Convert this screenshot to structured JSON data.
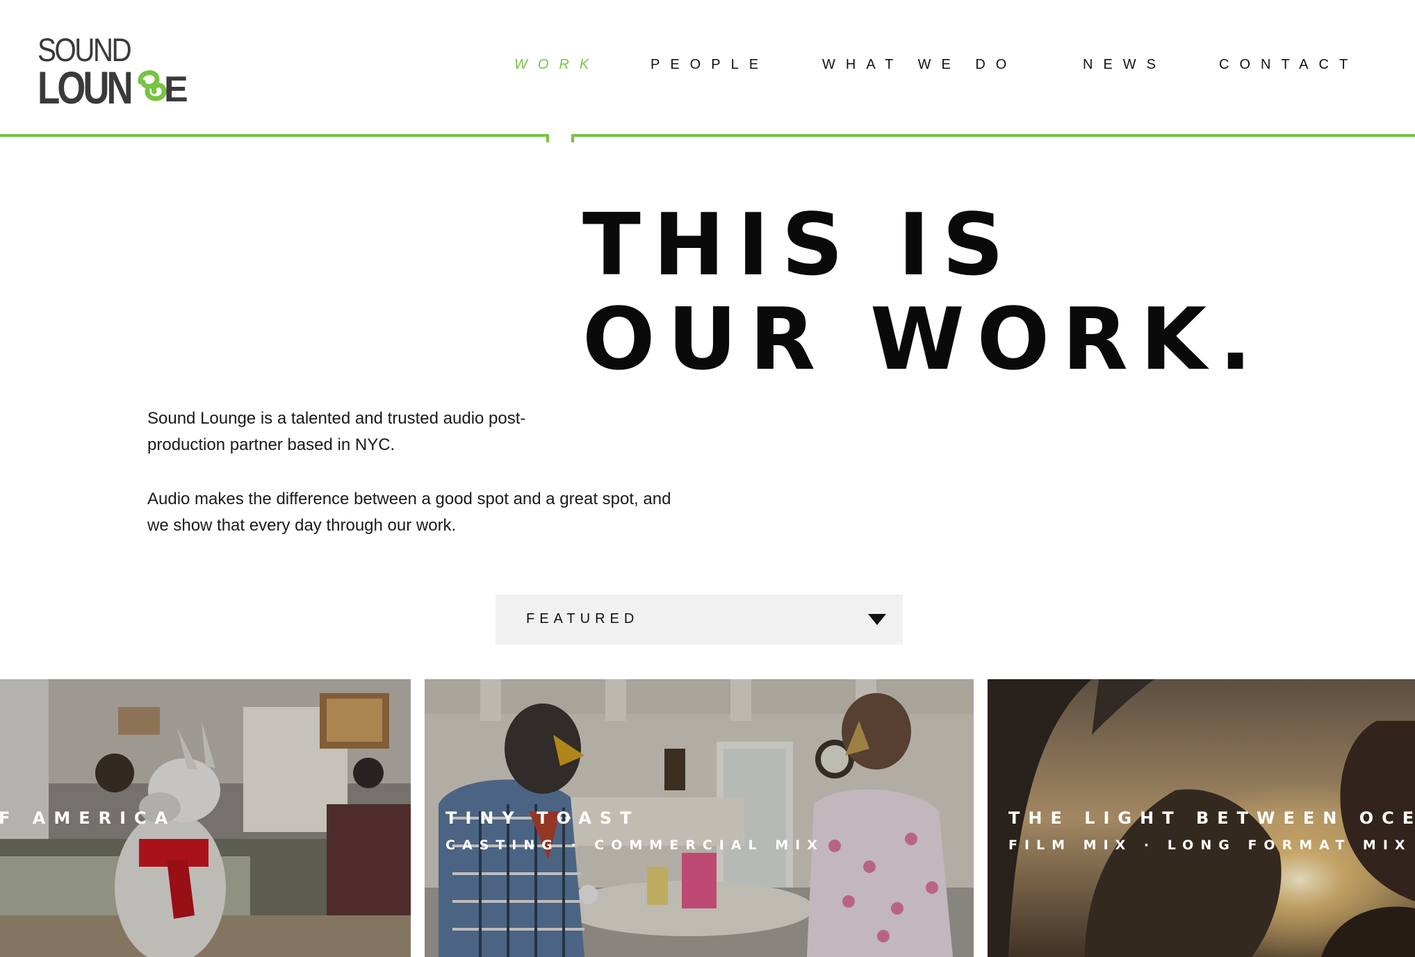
{
  "brand": {
    "line1": "SOUND",
    "line2": "LOUN",
    "line2_end": "E",
    "accent_color": "#76c442",
    "ink_color": "#3a3a3a"
  },
  "nav": {
    "items": [
      {
        "label": "WORK",
        "active": true
      },
      {
        "label": "PEOPLE",
        "active": false
      },
      {
        "label": "WHAT WE DO",
        "active": false
      },
      {
        "label": "NEWS",
        "active": false
      },
      {
        "label": "CONTACT",
        "active": false
      }
    ]
  },
  "hero": {
    "title_line1": "THIS IS",
    "title_line2": "OUR WORK."
  },
  "intro": {
    "paragraph1": "Sound Lounge is a talented and trusted audio post-production partner based in NYC.",
    "paragraph2": "Audio makes the difference between a good spot and a great spot, and we show that every day through our work."
  },
  "filter": {
    "selected": "FEATURED",
    "icon": "triangle-down-icon"
  },
  "tiles": [
    {
      "title": "F AMERICA",
      "subtitle": ""
    },
    {
      "title": "TINY TOAST",
      "subtitle": "CASTING · COMMERCIAL MIX"
    },
    {
      "title": "THE LIGHT BETWEEN OCE",
      "subtitle": "FILM MIX · LONG FORMAT MIX"
    }
  ]
}
